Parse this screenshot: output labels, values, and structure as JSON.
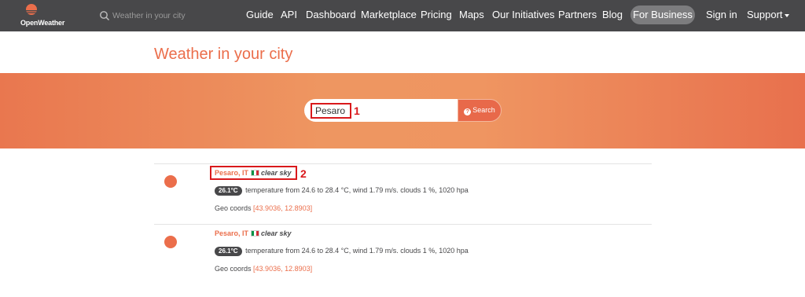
{
  "nav": {
    "logo_text": "OpenWeather",
    "search_placeholder": "Weather in your city",
    "links": [
      "Guide",
      "API",
      "Dashboard",
      "Marketplace",
      "Pricing",
      "Maps",
      "Our Initiatives",
      "Partners",
      "Blog"
    ],
    "business": "For Business",
    "sign_in": "Sign in",
    "support": "Support"
  },
  "page": {
    "title": "Weather in your city"
  },
  "search": {
    "value": "Pesaro",
    "button": "Search",
    "annotation": "1"
  },
  "results": [
    {
      "city": "Pesaro, IT",
      "condition": "clear sky",
      "temp_badge": "26.1°C",
      "details": "temperature from 24.6 to 28.4 °C, wind 1.79 m/s. clouds 1 %, 1020 hpa",
      "geo_label": "Geo coords",
      "geo_coords": "[43.9036, 12.8903]",
      "annotation": "2"
    },
    {
      "city": "Pesaro, IT",
      "condition": "clear sky",
      "temp_badge": "26.1°C",
      "details": "temperature from 24.6 to 28.4 °C, wind 1.79 m/s. clouds 1 %, 1020 hpa",
      "geo_label": "Geo coords",
      "geo_coords": "[43.9036, 12.8903]"
    }
  ],
  "colors": {
    "nav_bg": "#48484a",
    "accent": "#eb6e4b",
    "annotation": "#d9191c"
  }
}
